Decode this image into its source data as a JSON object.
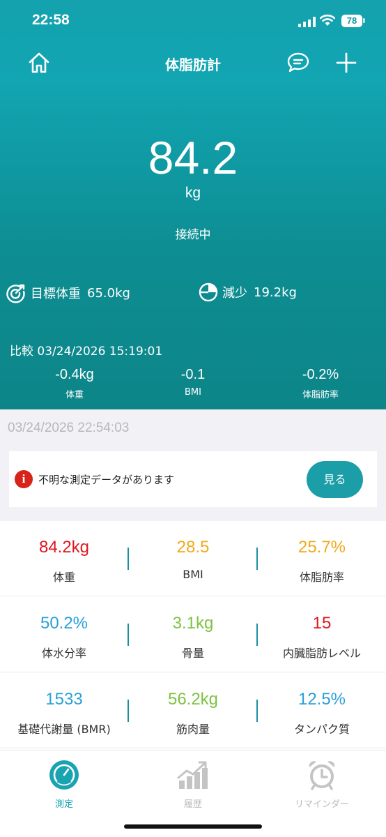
{
  "status_bar": {
    "time": "22:58",
    "battery": "78"
  },
  "nav": {
    "title": "体脂肪計"
  },
  "main": {
    "weight": "84.2",
    "unit": "kg",
    "connection": "接続中",
    "goal_label": "目標体重",
    "goal_value": "65.0kg",
    "decrease_label": "減少",
    "decrease_value": "19.2kg"
  },
  "comparison": {
    "title": "比較 03/24/2026 15:19:01",
    "items": [
      {
        "value": "-0.4kg",
        "label": "体重"
      },
      {
        "value": "-0.1",
        "label": "BMI"
      },
      {
        "value": "-0.2%",
        "label": "体脂肪率"
      }
    ]
  },
  "measurement_date": "03/24/2026 22:54:03",
  "alert": {
    "text": "不明な測定データがあります",
    "button": "見る"
  },
  "metrics": [
    {
      "value": "84.2kg",
      "label": "体重",
      "color": "#e0161f"
    },
    {
      "value": "28.5",
      "label": "BMI",
      "color": "#f0a91c"
    },
    {
      "value": "25.7%",
      "label": "体脂肪率",
      "color": "#f0a91c"
    },
    {
      "value": "50.2%",
      "label": "体水分率",
      "color": "#2a9fd8"
    },
    {
      "value": "3.1kg",
      "label": "骨量",
      "color": "#7ec242"
    },
    {
      "value": "15",
      "label": "内臓脂肪レベル",
      "color": "#e0161f"
    },
    {
      "value": "1533",
      "label": "基礎代謝量 (BMR)",
      "color": "#2a9fd8"
    },
    {
      "value": "56.2kg",
      "label": "筋肉量",
      "color": "#7ec242"
    },
    {
      "value": "12.5%",
      "label": "タンパク質",
      "color": "#2a9fd8"
    }
  ],
  "tabs": [
    {
      "label": "測定",
      "icon": "gauge-icon",
      "active": true
    },
    {
      "label": "履歴",
      "icon": "chart-icon",
      "active": false
    },
    {
      "label": "リマインダー",
      "icon": "alarm-clock-icon",
      "active": false
    }
  ],
  "colors": {
    "accent": "#1b9ea7",
    "tab_active": "#1aa3b0",
    "tab_inactive": "#b9b9b9"
  }
}
